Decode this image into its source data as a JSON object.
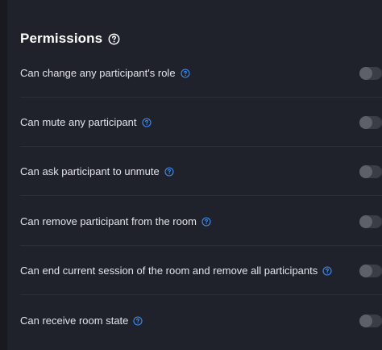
{
  "permissions": {
    "title": "Permissions",
    "title_icon": "question-circle-icon",
    "colors": {
      "background": "#1f222b",
      "text": "#e3e5ea",
      "info_icon": "#3d8ef0",
      "toggle_track": "#3a3d46",
      "toggle_knob": "#5d6069"
    },
    "items": [
      {
        "label": "Can change any participant's role",
        "icon": "info-icon",
        "enabled": false
      },
      {
        "label": "Can mute any participant",
        "icon": "info-icon",
        "enabled": false
      },
      {
        "label": "Can ask participant to unmute",
        "icon": "info-icon",
        "enabled": false
      },
      {
        "label": "Can remove participant from the room",
        "icon": "info-icon",
        "enabled": false
      },
      {
        "label": "Can end current session of the room and remove all participants",
        "icon": "info-icon",
        "enabled": false
      },
      {
        "label": "Can receive room state",
        "icon": "info-icon",
        "enabled": false
      }
    ]
  }
}
